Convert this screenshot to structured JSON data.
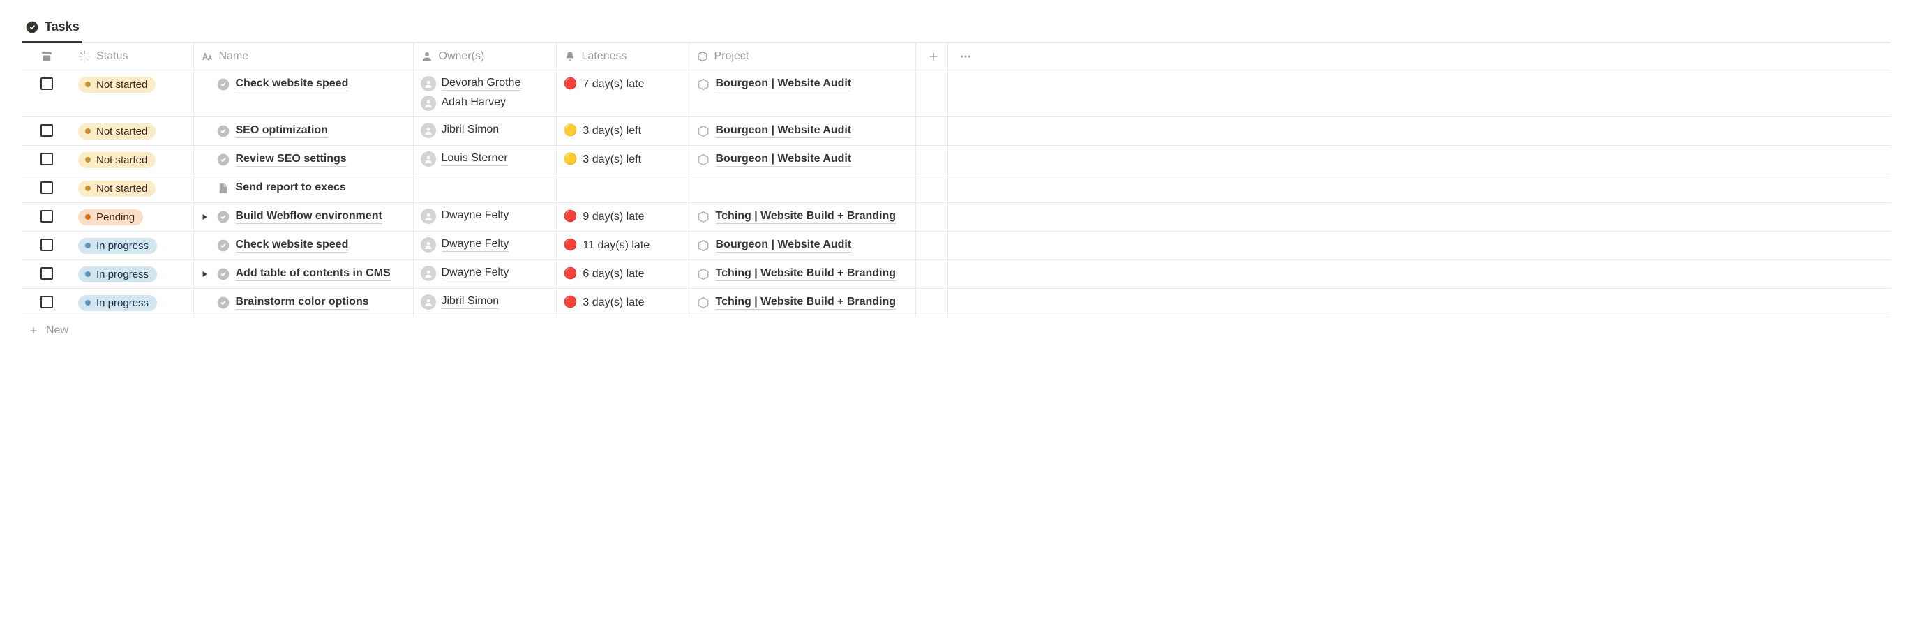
{
  "tab": {
    "label": "Tasks"
  },
  "columns": {
    "status": "Status",
    "name": "Name",
    "owners": "Owner(s)",
    "lateness": "Lateness",
    "project": "Project"
  },
  "newRow": {
    "label": "New"
  },
  "status_labels": {
    "not_started": "Not started",
    "pending": "Pending",
    "in_progress": "In progress"
  },
  "lateness_dots": {
    "late": "🔴",
    "soon": "🟡"
  },
  "rows": [
    {
      "status": "not_started",
      "has_toggle": false,
      "name_icon": "todo",
      "name": "Check website speed",
      "owners": [
        "Devorah Grothe",
        "Adah Harvey"
      ],
      "lateness_dot": "late",
      "lateness_text": "7 day(s) late",
      "project": "Bourgeon | Website Audit"
    },
    {
      "status": "not_started",
      "has_toggle": false,
      "name_icon": "todo",
      "name": "SEO optimization",
      "owners": [
        "Jibril Simon"
      ],
      "lateness_dot": "soon",
      "lateness_text": "3 day(s) left",
      "project": "Bourgeon | Website Audit"
    },
    {
      "status": "not_started",
      "has_toggle": false,
      "name_icon": "todo",
      "name": "Review SEO settings",
      "owners": [
        "Louis Sterner"
      ],
      "lateness_dot": "soon",
      "lateness_text": "3 day(s) left",
      "project": "Bourgeon | Website Audit"
    },
    {
      "status": "not_started",
      "has_toggle": false,
      "name_icon": "subpage",
      "name": "Send report to execs",
      "owners": [],
      "lateness_dot": "",
      "lateness_text": "",
      "project": ""
    },
    {
      "status": "pending",
      "has_toggle": true,
      "name_icon": "todo",
      "name": "Build Webflow environment",
      "owners": [
        "Dwayne Felty"
      ],
      "lateness_dot": "late",
      "lateness_text": "9 day(s) late",
      "project": "Tching | Website Build + Branding"
    },
    {
      "status": "in_progress",
      "has_toggle": false,
      "name_icon": "todo",
      "name": "Check website speed",
      "owners": [
        "Dwayne Felty"
      ],
      "lateness_dot": "late",
      "lateness_text": "11 day(s) late",
      "project": "Bourgeon | Website Audit"
    },
    {
      "status": "in_progress",
      "has_toggle": true,
      "name_icon": "todo",
      "name": "Add table of contents in CMS",
      "owners": [
        "Dwayne Felty"
      ],
      "lateness_dot": "late",
      "lateness_text": "6 day(s) late",
      "project": "Tching | Website Build + Branding"
    },
    {
      "status": "in_progress",
      "has_toggle": false,
      "name_icon": "todo",
      "name": "Brainstorm color options",
      "owners": [
        "Jibril Simon"
      ],
      "lateness_dot": "late",
      "lateness_text": "3 day(s) late",
      "project": "Tching | Website Build + Branding"
    }
  ]
}
